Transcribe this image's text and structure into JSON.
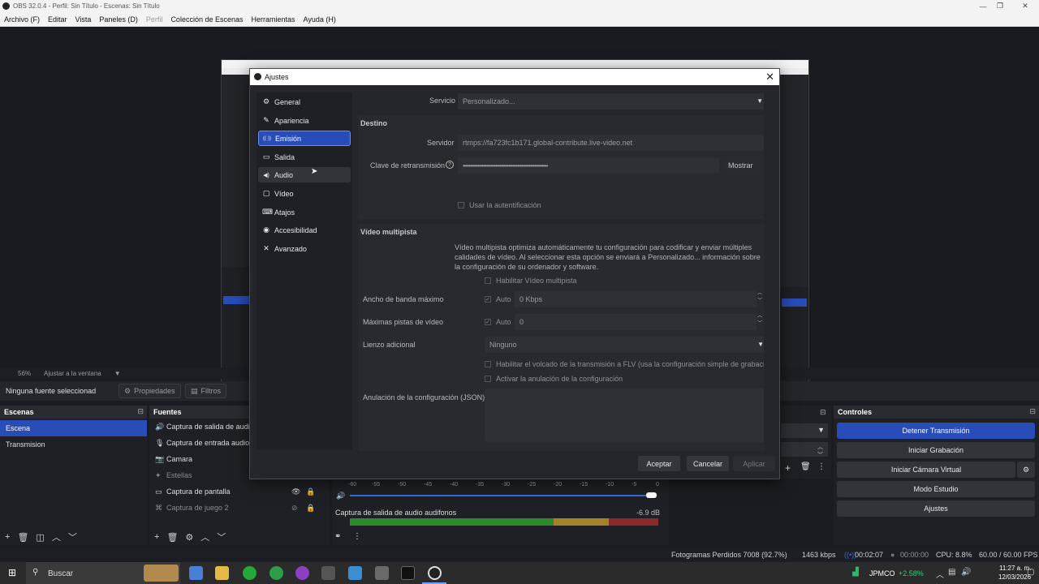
{
  "window": {
    "title": "OBS 32.0.4 - Perfil: Sin Título - Escenas: Sin Título"
  },
  "menu": [
    {
      "label": "Archivo (F)",
      "disabled": false
    },
    {
      "label": "Editar",
      "disabled": false
    },
    {
      "label": "Vista",
      "disabled": false
    },
    {
      "label": "Paneles (D)",
      "disabled": false
    },
    {
      "label": "Perfil",
      "disabled": true
    },
    {
      "label": "Colección de Escenas",
      "disabled": false
    },
    {
      "label": "Herramientas",
      "disabled": false
    },
    {
      "label": "Ayuda (H)",
      "disabled": false
    }
  ],
  "zoombar": {
    "zoom": "56%",
    "fit": "Ajustar a la ventana"
  },
  "sourcebar": {
    "selection": "Ninguna fuente seleccionad",
    "properties": "Propiedades",
    "filters": "Filtros"
  },
  "scenes": {
    "title": "Escenas",
    "items": [
      "Escena",
      "Transmision"
    ]
  },
  "sources": {
    "title": "Fuentes",
    "items": [
      {
        "label": "Captura de salida de audi",
        "icon": "speaker-icon"
      },
      {
        "label": "Captura de entrada audio",
        "icon": "microphone-icon"
      },
      {
        "label": "Camara",
        "icon": "camera-icon"
      },
      {
        "label": "Estellas",
        "icon": "star-icon"
      },
      {
        "label": "Captura de pantalla",
        "icon": "monitor-icon"
      },
      {
        "label": "Captura de juego 2",
        "icon": "gamepad-icon"
      }
    ]
  },
  "mixer": {
    "ticks": [
      "-60",
      "-55",
      "-50",
      "-45",
      "-40",
      "-35",
      "-30",
      "-25",
      "-20",
      "-15",
      "-10",
      "-5",
      "0"
    ],
    "track_name": "Captura de salida de audio audifonos",
    "track_level": "-6.9 dB"
  },
  "controls": {
    "title": "Controles",
    "buttons": [
      "Detener Transmisión",
      "Iniciar Grabación",
      "Iniciar Cámara Virtual",
      "Modo Estudio",
      "Ajustes"
    ]
  },
  "status": {
    "dropped": "Fotogramas Perdidos 7008 (92.7%)",
    "bitrate": "1463 kbps",
    "stream_time": "00:02:07",
    "rec_time": "00:00:00",
    "cpu": "CPU: 8.8%",
    "fps": "60.00 / 60.00 FPS"
  },
  "taskbar": {
    "search": "Buscar",
    "ticker": "JPMCO",
    "change": "+2.58%",
    "time": "11:27 a. m.",
    "date": "12/03/2026"
  },
  "dialog": {
    "title": "Ajustes",
    "nav": [
      {
        "label": "General",
        "icon": "gear-icon",
        "glyph": "⚙"
      },
      {
        "label": "Apariencia",
        "icon": "brush-icon",
        "glyph": "✎"
      },
      {
        "label": "Emisión",
        "icon": "broadcast-icon",
        "glyph": "((·))"
      },
      {
        "label": "Salida",
        "icon": "output-icon",
        "glyph": "▭"
      },
      {
        "label": "Audio",
        "icon": "speaker-icon",
        "glyph": "◀)"
      },
      {
        "label": "Vídeo",
        "icon": "video-icon",
        "glyph": "▢"
      },
      {
        "label": "Atajos",
        "icon": "keyboard-icon",
        "glyph": "⌨"
      },
      {
        "label": "Accesibilidad",
        "icon": "accessibility-icon",
        "glyph": "◉"
      },
      {
        "label": "Avanzado",
        "icon": "tools-icon",
        "glyph": "✕"
      }
    ],
    "service": {
      "label": "Servicio",
      "value": "Personalizado..."
    },
    "destination": {
      "header": "Destino",
      "server_label": "Servidor",
      "server_value": "rtmps://fa723fc1b171.global-contribute.live-video.net",
      "key_label": "Clave de retransmisión",
      "key_value": "••••••••••••••••••••••••••••••••••••••••••••••••••••••••••",
      "show": "Mostrar",
      "use_auth": "Usar la autentificación"
    },
    "multitrack": {
      "header": "Vídeo multipista",
      "description": "Vídeo multipista optimiza automáticamente tu configuración para codificar y enviar múltiples calidades de vídeo. Al seleccionar esta opción se enviará a Personalizado... información sobre la configuración de su ordenador y software.",
      "enable": "Habilitar Vídeo multipista",
      "bandwidth_label": "Ancho de banda máximo",
      "bandwidth_auto": "Auto",
      "bandwidth_value": "0 Kbps",
      "tracks_label": "Máximas pistas de vídeo",
      "tracks_auto": "Auto",
      "tracks_value": "0",
      "canvas_label": "Lienzo adicional",
      "canvas_value": "Ninguno",
      "flv_dump": "Habilitar el volcado de la transmisión a FLV (usa la configuración simple de grabació",
      "override": "Activar la anulación de la configuración",
      "json_label": "Anulación de la configuración (JSON)"
    },
    "buttons": {
      "accept": "Aceptar",
      "cancel": "Cancelar",
      "apply": "Aplicar"
    }
  }
}
